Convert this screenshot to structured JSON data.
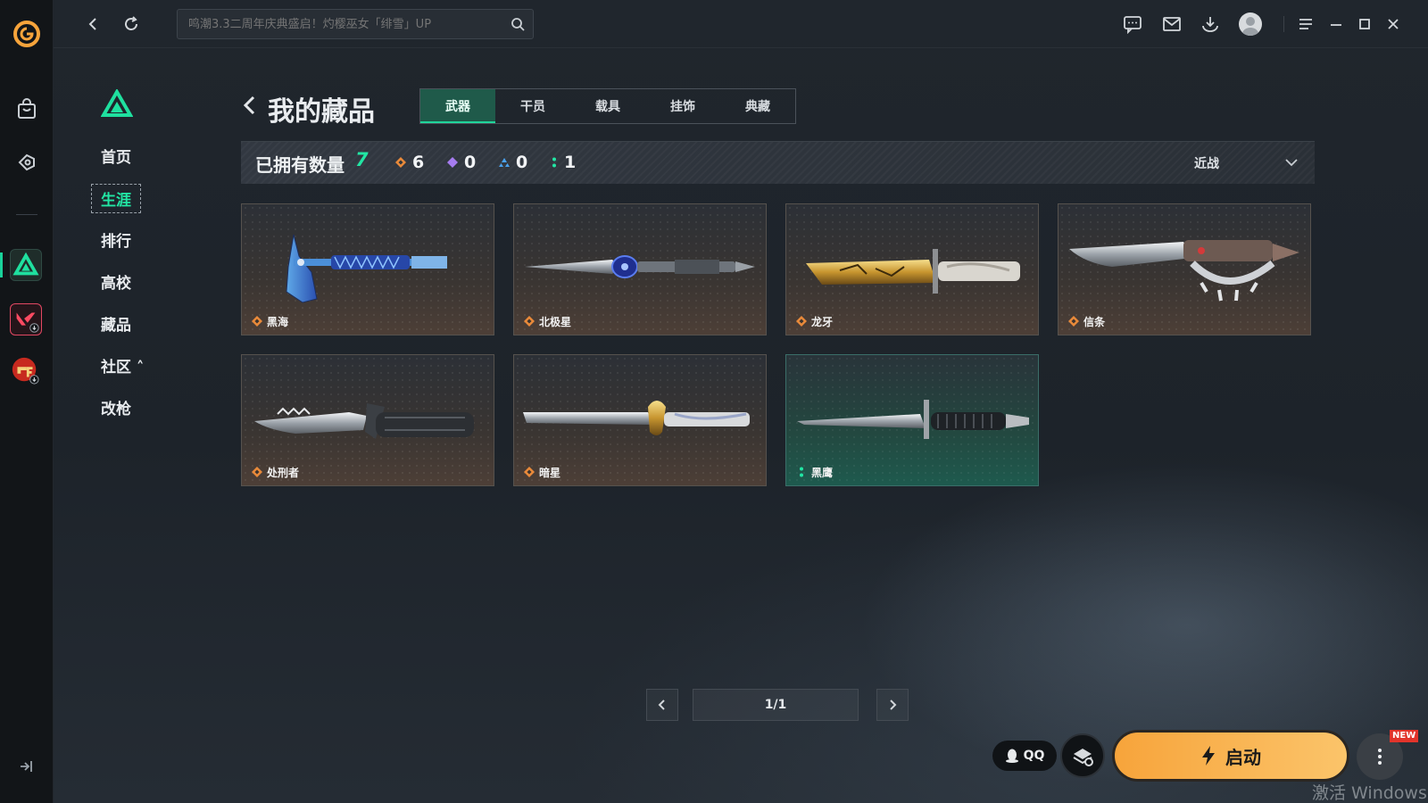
{
  "topbar": {
    "search_placeholder": "鸣潮3.3二周年庆典盛启！灼樱巫女「绯雪」UP"
  },
  "subnav": {
    "items": [
      {
        "label": "首页"
      },
      {
        "label": "生涯",
        "active": true
      },
      {
        "label": "排行"
      },
      {
        "label": "高校"
      },
      {
        "label": "藏品"
      },
      {
        "label": "社区 ˄"
      },
      {
        "label": "改枪"
      }
    ]
  },
  "page": {
    "title": "我的藏品",
    "tabs": [
      {
        "label": "武器",
        "active": true
      },
      {
        "label": "干员"
      },
      {
        "label": "载具"
      },
      {
        "label": "挂饰"
      },
      {
        "label": "典藏"
      }
    ]
  },
  "stats": {
    "owned_label": "已拥有数量",
    "owned_total": "7",
    "counts": [
      {
        "rarity": "orange",
        "color": "#e98a3a",
        "value": "6"
      },
      {
        "rarity": "purple",
        "color": "#a67cf0",
        "value": "0"
      },
      {
        "rarity": "blue",
        "color": "#4aa3f0",
        "value": "0"
      },
      {
        "rarity": "green",
        "color": "#22e6a4",
        "value": "1"
      }
    ],
    "filter_value": "近战"
  },
  "items": [
    {
      "name": "黑海",
      "rarity": "orange",
      "icon": "axe-icon"
    },
    {
      "name": "北极星",
      "rarity": "orange",
      "icon": "dagger-icon"
    },
    {
      "name": "龙牙",
      "rarity": "orange",
      "icon": "gold-knife-icon"
    },
    {
      "name": "信条",
      "rarity": "orange",
      "icon": "knuckle-knife-icon"
    },
    {
      "name": "处刑者",
      "rarity": "orange",
      "icon": "serrated-knife-icon"
    },
    {
      "name": "暗星",
      "rarity": "orange",
      "icon": "blade-icon"
    },
    {
      "name": "黑鹰",
      "rarity": "green",
      "icon": "combat-knife-icon"
    }
  ],
  "pager": {
    "label": "1/1"
  },
  "actions": {
    "qq_label": "QQ",
    "launch_label": "启动",
    "new_badge": "NEW"
  },
  "watermark": "激活 Windows",
  "colors": {
    "accent": "#22e6a4",
    "launch": "#f9b553",
    "orange_rarity": "#e98a3a"
  }
}
